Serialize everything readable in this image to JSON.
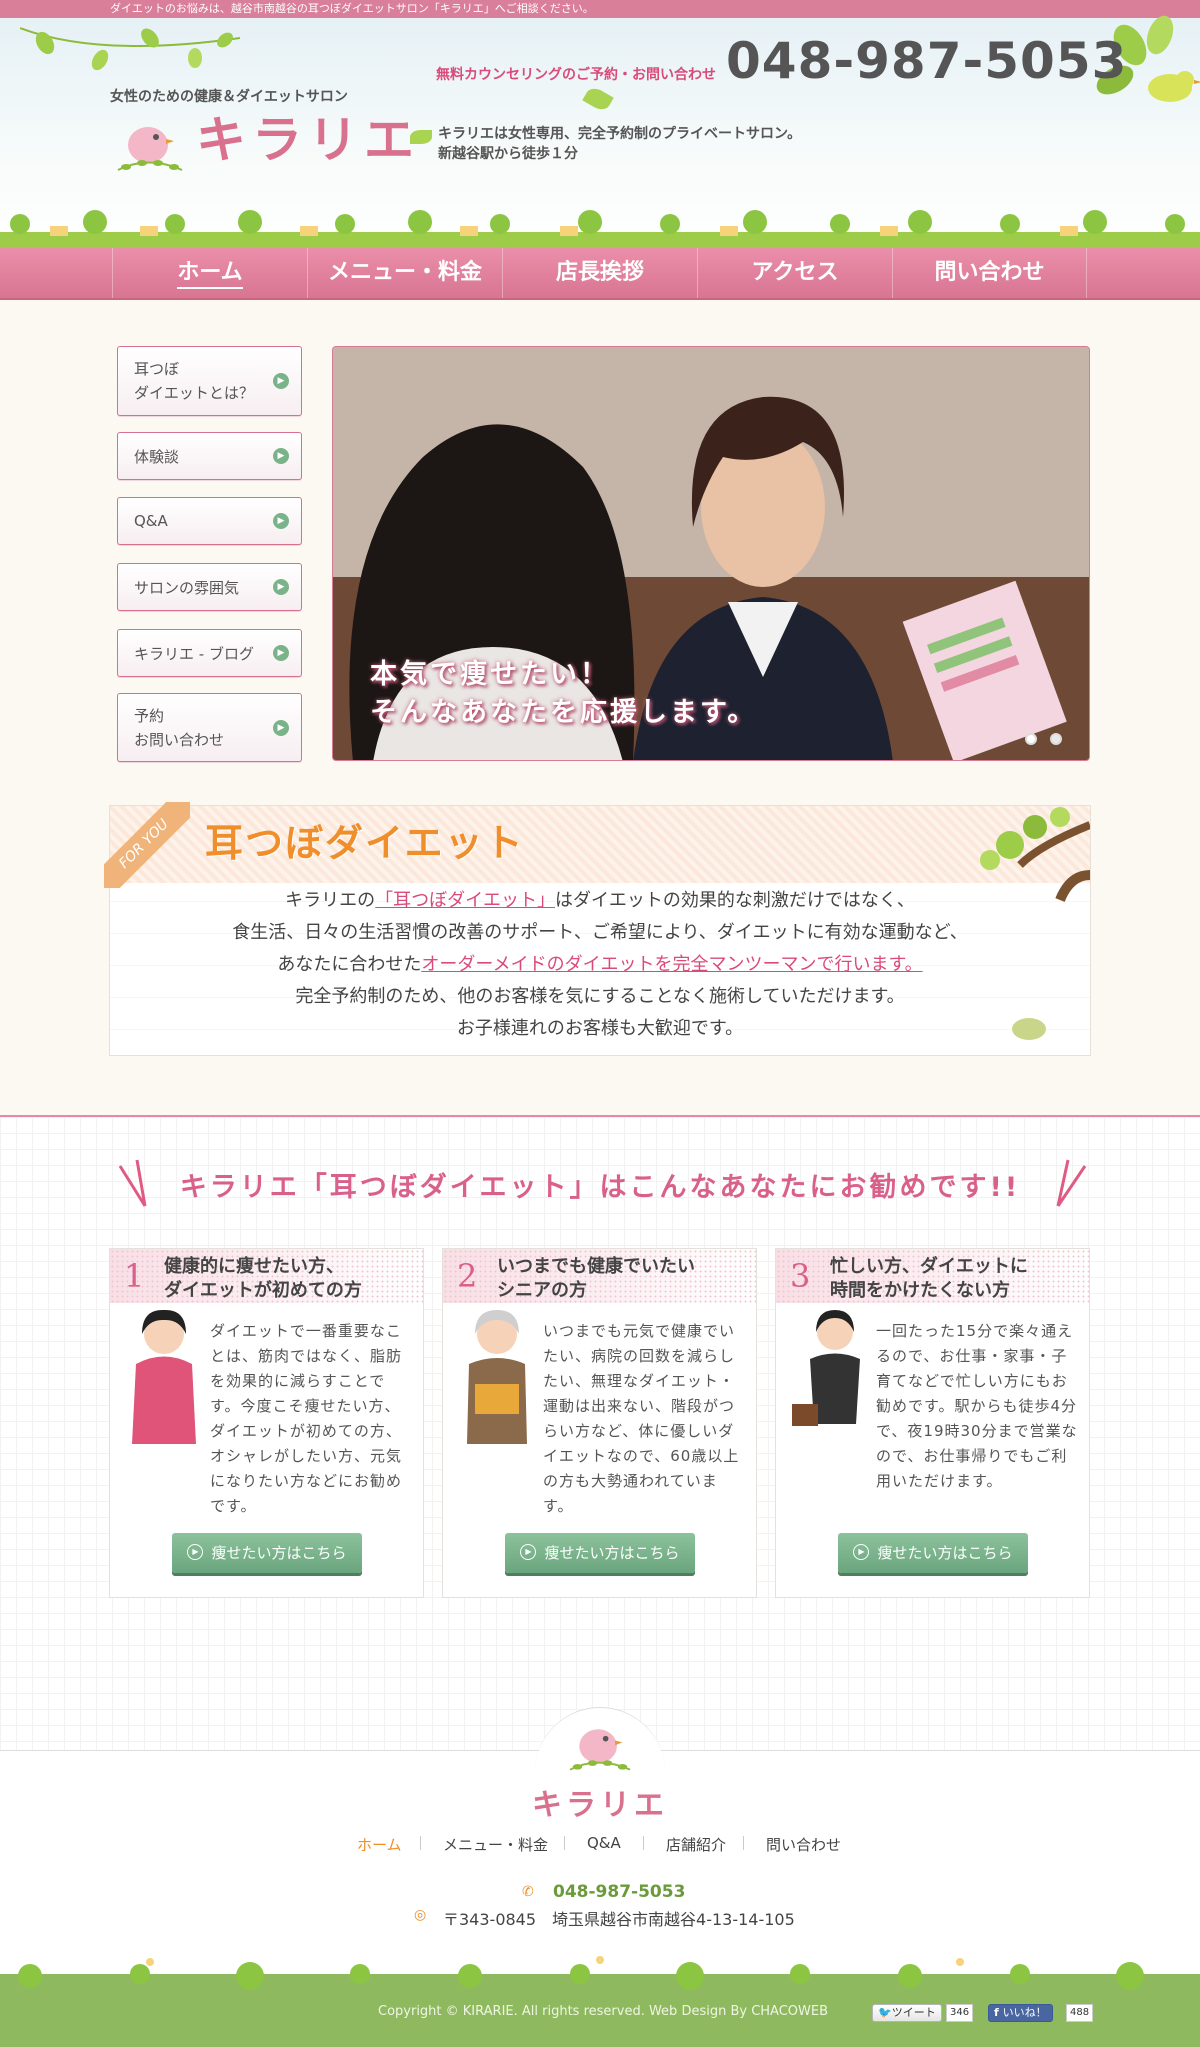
{
  "topbar": {
    "text": "ダイエットのお悩みは、越谷市南越谷の耳つぼダイエットサロン「キラリエ」へご相談ください。"
  },
  "header": {
    "tagline": "女性のための健康＆ダイエットサロン",
    "logo": "キラリエ",
    "intro_line1": "キラリエは女性専用、完全予約制のプライベートサロン。",
    "intro_line2": "新越谷駅から徒歩１分",
    "counsel": "無料カウンセリングのご予約・お問い合わせ",
    "tel": "048-987-5053"
  },
  "nav": [
    {
      "label": "ホーム"
    },
    {
      "label": "メニュー・料金"
    },
    {
      "label": "店長挨拶"
    },
    {
      "label": "アクセス"
    },
    {
      "label": "問い合わせ"
    }
  ],
  "side": [
    {
      "line1": "耳つぼ",
      "line2": "ダイエットとは？"
    },
    {
      "line1": "体験談",
      "line2": ""
    },
    {
      "line1": "Q&A",
      "line2": ""
    },
    {
      "line1": "サロンの雰囲気",
      "line2": ""
    },
    {
      "line1": "キラリエ - ブログ",
      "line2": ""
    },
    {
      "line1": "予約",
      "line2": "お問い合わせ"
    }
  ],
  "slider": {
    "caption1": "本気で痩せたい！",
    "caption2": "そんなあなたを応援します。"
  },
  "about": {
    "badge": "FOR YOU",
    "title": "耳つぼダイエット",
    "l1a": "キラリエの",
    "l1b": "「耳つぼダイエット」",
    "l1c": "はダイエットの効果的な刺激だけではなく、",
    "l2": "食生活、日々の生活習慣の改善のサポート、ご希望により、ダイエットに有効な運動など、",
    "l3a": "あなたに合わせた",
    "l3b": "オーダーメイドのダイエットを完全マンツーマンで行います。",
    "l4": "完全予約制のため、他のお客様を気にすることなく施術していただけます。",
    "l5": "お子様連れのお客様も大歓迎です。"
  },
  "recommend": {
    "title": "キラリエ「耳つぼダイエット」はこんなあなたにお勧めです!!",
    "cards": [
      {
        "num": "1",
        "title1": "健康的に痩せたい方、",
        "title2": "ダイエットが初めての方",
        "text": "ダイエットで一番重要なことは、筋肉ではなく、脂肪を効果的に減らすことです。今度こそ痩せたい方、ダイエットが初めての方、オシャレがしたい方、元気になりたい方などにお勧めです。",
        "button": "痩せたい方はこちら"
      },
      {
        "num": "2",
        "title1": "いつまでも健康でいたい",
        "title2": "シニアの方",
        "text": "いつまでも元気で健康でいたい、病院の回数を減らしたい、無理なダイエット・運動は出来ない、階段がつらい方など、体に優しいダイエットなので、60歳以上の方も大勢通われています。",
        "button": "痩せたい方はこちら"
      },
      {
        "num": "3",
        "title1": "忙しい方、ダイエットに",
        "title2": "時間をかけたくない方",
        "text": "一回たった15分で楽々通えるので、お仕事・家事・子育てなどで忙しい方にもお勧めです。駅からも徒歩4分で、夜19時30分まで営業なので、お仕事帰りでもご利用いただけます。",
        "button": "痩せたい方はこちら"
      }
    ]
  },
  "footer": {
    "logo": "キラリエ",
    "nav": [
      "ホーム",
      "メニュー・料金",
      "Q&A",
      "店舗紹介",
      "問い合わせ"
    ],
    "tel": "048-987-5053",
    "address": "〒343-0845　埼玉県越谷市南越谷4-13-14-105",
    "copyright": "Copyright © KIRARIE. All rights reserved. Web Design By CHACOWEB",
    "tweet": "ツイート",
    "tweet_count": "346",
    "like": "いいね！",
    "like_count": "488"
  }
}
